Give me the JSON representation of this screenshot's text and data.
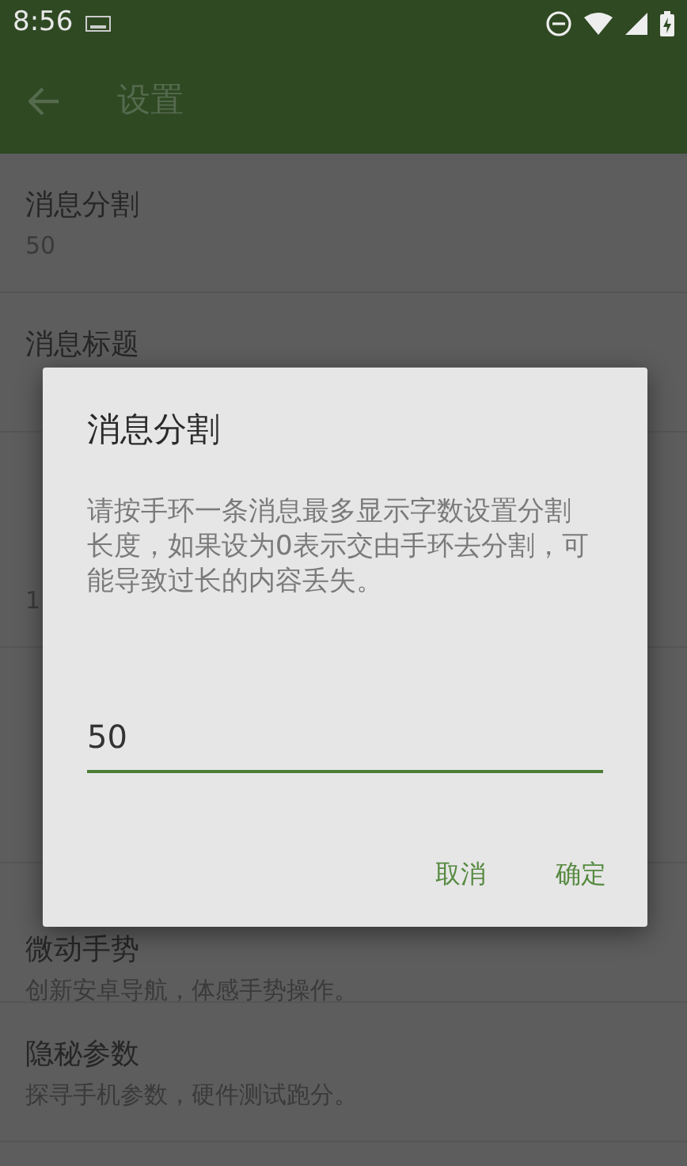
{
  "status_bar": {
    "time": "8:56"
  },
  "app_bar": {
    "title": "设置"
  },
  "settings": [
    {
      "kind": "item",
      "title": "消息分割",
      "summary": "50"
    },
    {
      "kind": "item",
      "title": "消息标题"
    },
    {
      "kind": "header"
    },
    {
      "kind": "item",
      "summary": "1"
    },
    {
      "kind": "header"
    },
    {
      "kind": "item"
    },
    {
      "kind": "item",
      "title": "微动手势",
      "summary": "创新安卓导航，体感手势操作。"
    },
    {
      "kind": "item",
      "title": "隐秘参数",
      "summary": "探寻手机参数，硬件测试跑分。"
    }
  ],
  "dialog": {
    "title": "消息分割",
    "message": "请按手环一条消息最多显示字数设置分割长度，如果设为0表示交由手环去分割，可能导致过长的内容丢失。",
    "value": "50",
    "buttons": [
      "取消",
      "确定"
    ]
  }
}
